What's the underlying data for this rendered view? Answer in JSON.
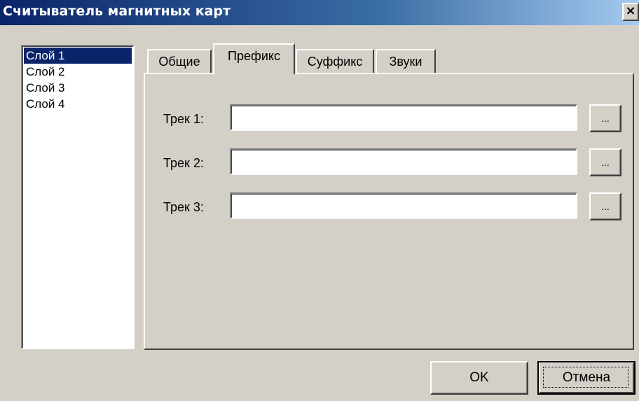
{
  "window": {
    "title": "Считыватель магнитных карт",
    "close_icon": "close-icon",
    "close_glyph": "×"
  },
  "layers": [
    {
      "label": "Слой 1",
      "selected": true
    },
    {
      "label": "Слой 2",
      "selected": false
    },
    {
      "label": "Слой 3",
      "selected": false
    },
    {
      "label": "Слой 4",
      "selected": false
    }
  ],
  "tabs": [
    {
      "label": "Общие",
      "active": false
    },
    {
      "label": "Префикс",
      "active": true
    },
    {
      "label": "Суффикс",
      "active": false
    },
    {
      "label": "Звуки",
      "active": false
    }
  ],
  "tracks": [
    {
      "label": "Трек 1:",
      "value": "",
      "browse_label": "..."
    },
    {
      "label": "Трек 2:",
      "value": "",
      "browse_label": "..."
    },
    {
      "label": "Трек 3:",
      "value": "",
      "browse_label": "..."
    }
  ],
  "buttons": {
    "ok_label": "OK",
    "cancel_label": "Отмена"
  },
  "colors": {
    "titlebar_start": "#0a246a",
    "titlebar_end": "#a6caf0",
    "face": "#d4d0c8",
    "selection": "#0a246a"
  }
}
